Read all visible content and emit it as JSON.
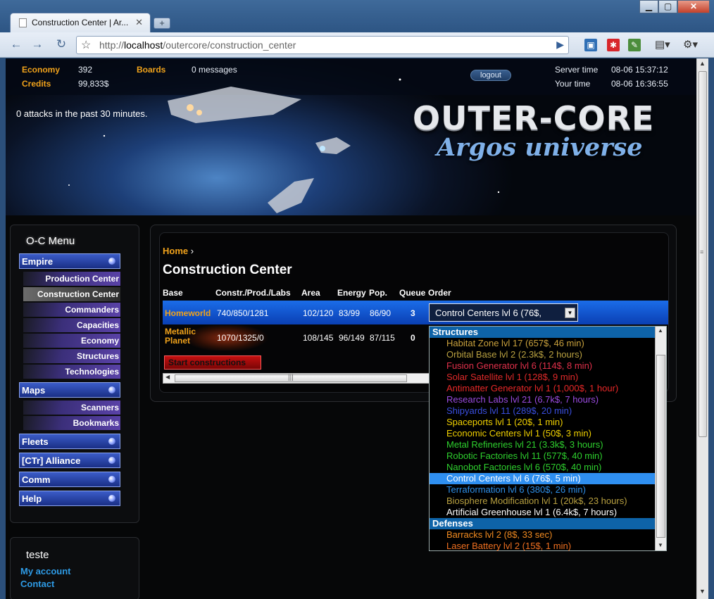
{
  "browser": {
    "tab_title": "Construction Center | Ar...",
    "url_prefix": "http://",
    "url_host": "localhost",
    "url_path": "/outercore/construction_center"
  },
  "header": {
    "economy_label": "Economy",
    "economy_value": "392",
    "credits_label": "Credits",
    "credits_value": "99,833$",
    "boards_label": "Boards",
    "messages": "0 messages",
    "logout": "logout",
    "server_time_label": "Server time",
    "server_time_value": "08-06 15:37:12",
    "your_time_label": "Your time",
    "your_time_value": "08-06 16:36:55",
    "attacks": "0 attacks in the past 30 minutes.",
    "logo_title": "OUTER-CORE",
    "logo_subtitle": "Argos universe"
  },
  "menu": {
    "title": "O-C Menu",
    "empire": "Empire",
    "empire_items": [
      "Production Center",
      "Construction Center",
      "Commanders",
      "Capacities",
      "Economy",
      "Structures",
      "Technologies"
    ],
    "maps": "Maps",
    "maps_items": [
      "Scanners",
      "Bookmarks"
    ],
    "fleets": "Fleets",
    "alliance": "[CTr] Alliance",
    "comm": "Comm",
    "help": "Help"
  },
  "account": {
    "title": "teste",
    "my_account": "My account",
    "contact": "Contact"
  },
  "main": {
    "breadcrumb_home": "Home",
    "breadcrumb_sep": "›",
    "page_title": "Construction Center",
    "columns": [
      "Base",
      "Constr./Prod./Labs",
      "Area",
      "Energy",
      "Pop.",
      "Queue",
      "Order"
    ],
    "rows": [
      {
        "base": "Homeworld",
        "cpl": "740/850/1281",
        "area": "102/120",
        "energy": "83/99",
        "pop": "86/90",
        "queue": "3",
        "order": "Control Centers lvl 6 (76$,"
      },
      {
        "base": "Metallic Planet",
        "cpl": "1070/1325/0",
        "area": "108/145",
        "energy": "96/149",
        "pop": "87/115",
        "queue": "0"
      }
    ],
    "start_button": "Start constructions"
  },
  "dropdown": {
    "group_structures": "Structures",
    "structures": [
      {
        "label": "Habitat Zone lvl 17 (657$, 46 min)",
        "color": "#c8a03c"
      },
      {
        "label": "Orbital Base lvl 2 (2.3k$, 2 hours)",
        "color": "#b8a040"
      },
      {
        "label": "Fusion Generator lvl 6 (114$, 8 min)",
        "color": "#e0304a"
      },
      {
        "label": "Solar Satellite lvl 1 (128$, 9 min)",
        "color": "#e02a2a"
      },
      {
        "label": "Antimatter Generator lvl 1 (1,000$, 1 hour)",
        "color": "#e82828"
      },
      {
        "label": "Research Labs lvl 21 (6.7k$, 7 hours)",
        "color": "#9a4be0"
      },
      {
        "label": "Shipyards lvl 11 (289$, 20 min)",
        "color": "#3a4fe0"
      },
      {
        "label": "Spaceports lvl 1 (20$, 1 min)",
        "color": "#f0d000"
      },
      {
        "label": "Economic Centers lvl 1 (50$, 3 min)",
        "color": "#f0d000"
      },
      {
        "label": "Metal Refineries lvl 21 (3.3k$, 3 hours)",
        "color": "#2ed02e"
      },
      {
        "label": "Robotic Factories lvl 11 (577$, 40 min)",
        "color": "#2ed02e"
      },
      {
        "label": "Nanobot Factories lvl 6 (570$, 40 min)",
        "color": "#2ed02e"
      },
      {
        "label": "Control Centers lvl 6 (76$, 5 min)",
        "color": "#ffffff",
        "selected": true
      },
      {
        "label": "Terraformation lvl 6 (380$, 26 min)",
        "color": "#2e8fe8"
      },
      {
        "label": "Biosphere Modification lvl 1 (20k$, 23 hours)",
        "color": "#b8a040"
      },
      {
        "label": "Artificial Greenhouse lvl 1 (6.4k$, 7 hours)",
        "color": "#ffffff"
      }
    ],
    "group_defenses": "Defenses",
    "defenses": [
      {
        "label": "Barracks lvl 2 (8$, 33 sec)",
        "color": "#f08a20"
      },
      {
        "label": "Laser Battery lvl 2 (15$, 1 min)",
        "color": "#f07020"
      }
    ]
  }
}
